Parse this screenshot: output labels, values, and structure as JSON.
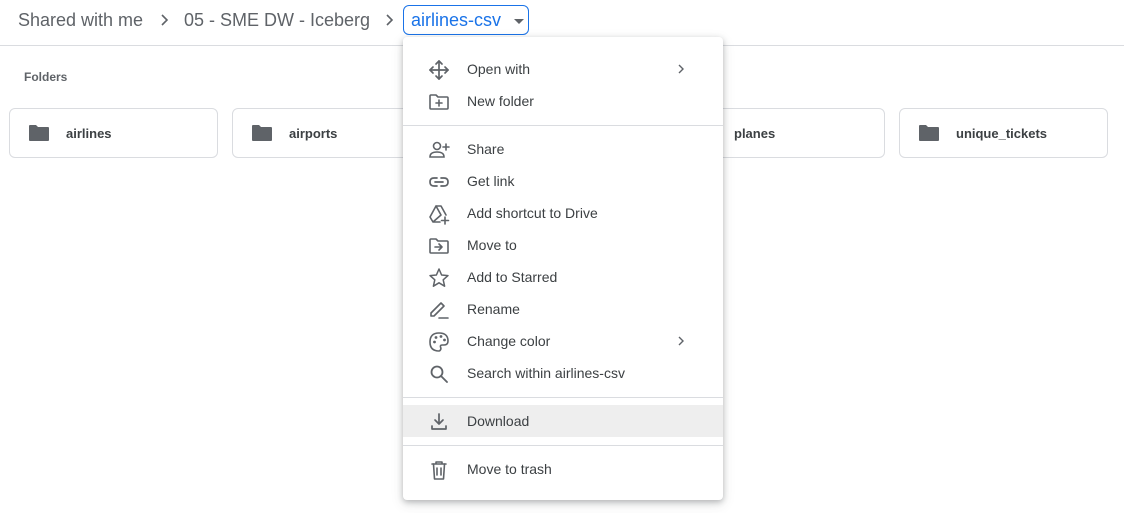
{
  "breadcrumb": {
    "items": [
      "Shared with me",
      "05 - SME DW - Iceberg"
    ],
    "current": "airlines-csv"
  },
  "folders": {
    "section_title": "Folders",
    "items": [
      "airlines",
      "airports",
      "planes",
      "unique_tickets"
    ]
  },
  "menu": {
    "groups": [
      [
        {
          "label": "Open with",
          "icon": "move-arrows-icon",
          "submenu": true
        },
        {
          "label": "New folder",
          "icon": "new-folder-icon"
        }
      ],
      [
        {
          "label": "Share",
          "icon": "add-person-icon"
        },
        {
          "label": "Get link",
          "icon": "link-icon"
        },
        {
          "label": "Add shortcut to Drive",
          "icon": "add-shortcut-icon"
        },
        {
          "label": "Move to",
          "icon": "move-to-folder-icon"
        },
        {
          "label": "Add to Starred",
          "icon": "star-icon"
        },
        {
          "label": "Rename",
          "icon": "pencil-icon"
        },
        {
          "label": "Change color",
          "icon": "palette-icon",
          "submenu": true
        },
        {
          "label": "Search within airlines-csv",
          "icon": "search-icon"
        }
      ],
      [
        {
          "label": "Download",
          "icon": "download-icon",
          "highlighted": true
        }
      ],
      [
        {
          "label": "Move to trash",
          "icon": "trash-icon"
        }
      ]
    ]
  },
  "colors": {
    "accent": "#1a73e8",
    "text": "#3c4043",
    "secondary_text": "#5f6368",
    "border": "#dadce0",
    "highlight": "#eeeeee"
  }
}
